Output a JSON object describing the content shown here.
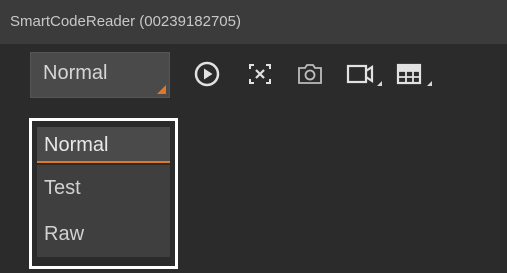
{
  "window": {
    "title": "SmartCodeReader (00239182705)"
  },
  "toolbar": {
    "mode_value": "Normal",
    "tools": [
      {
        "icon": "play-icon"
      },
      {
        "icon": "scan-icon"
      },
      {
        "icon": "camera-icon"
      },
      {
        "icon": "video-camera-icon"
      },
      {
        "icon": "grid-icon"
      }
    ]
  },
  "mode_dropdown": {
    "options": [
      "Normal",
      "Test",
      "Raw"
    ],
    "selected": "Normal"
  },
  "colors": {
    "accent": "#e0782a",
    "background": "#2b2b2b",
    "titlebar": "#3b3b3b"
  }
}
